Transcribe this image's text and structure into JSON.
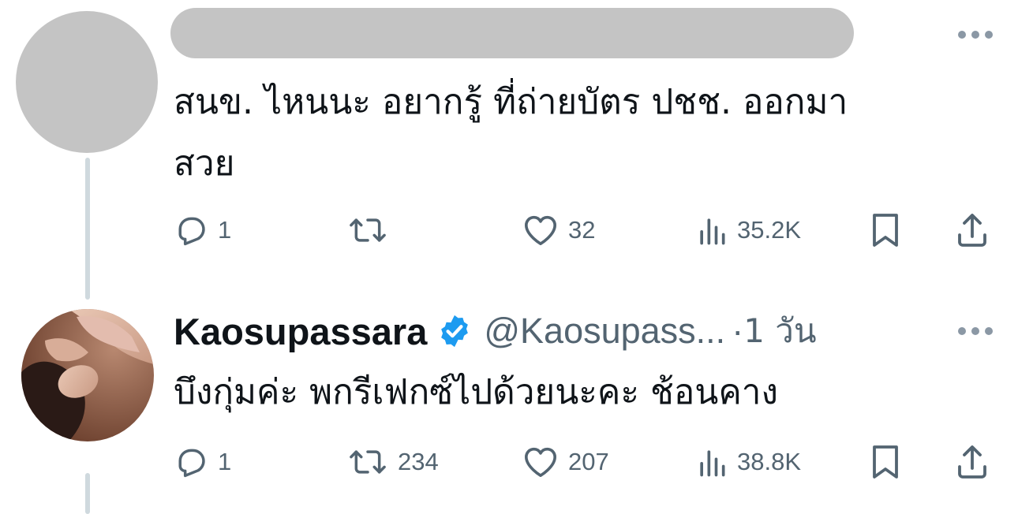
{
  "tweet1": {
    "text": "สนข. ไหนนะ อยากรู้ ที่ถ่ายบัตร ปชช. ออกมา",
    "text_line2": "สวย",
    "actions": {
      "replies": "1",
      "retweets": "",
      "likes": "32",
      "views": "35.2K"
    }
  },
  "tweet2": {
    "display_name": "Kaosupassara",
    "handle": "@Kaosupass...",
    "separator": "·",
    "time": "1 วัน",
    "text": "บึงกุ่มค่ะ พกรีเฟกซ์ไปด้วยนะคะ ช้อนคาง",
    "actions": {
      "replies": "1",
      "retweets": "234",
      "likes": "207",
      "views": "38.8K"
    }
  },
  "colors": {
    "text": "#0f1419",
    "muted": "#536471",
    "verified": "#1d9bf0",
    "thread_line": "#cfd9de",
    "redaction": "#c4c4c4"
  },
  "icons": [
    "reply-icon",
    "retweet-icon",
    "like-icon",
    "views-icon",
    "bookmark-icon",
    "share-icon",
    "more-icon",
    "verified-badge-icon"
  ]
}
